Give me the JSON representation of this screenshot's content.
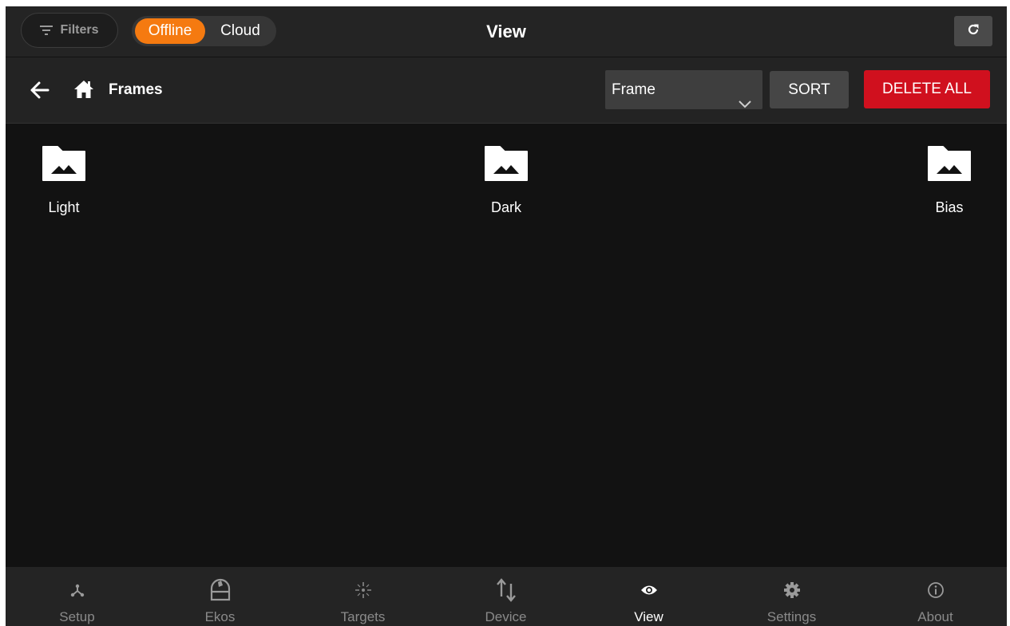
{
  "header": {
    "filters_label": "Filters",
    "mode_offline": "Offline",
    "mode_cloud": "Cloud",
    "title": "View"
  },
  "toolbar": {
    "breadcrumb": "Frames",
    "select_value": "Frame",
    "sort_label": "SORT",
    "delete_all_label": "DELETE ALL"
  },
  "folders": [
    {
      "label": "Light",
      "icon": "image-folder-icon"
    },
    {
      "label": "Dark",
      "icon": "image-folder-icon"
    },
    {
      "label": "Bias",
      "icon": "image-folder-icon"
    }
  ],
  "nav": [
    {
      "label": "Setup",
      "icon": "setup-icon",
      "active": false
    },
    {
      "label": "Ekos",
      "icon": "ekos-icon",
      "active": false
    },
    {
      "label": "Targets",
      "icon": "targets-icon",
      "active": false
    },
    {
      "label": "Device",
      "icon": "device-icon",
      "active": false
    },
    {
      "label": "View",
      "icon": "eye-icon",
      "active": true
    },
    {
      "label": "Settings",
      "icon": "gear-icon",
      "active": false
    },
    {
      "label": "About",
      "icon": "info-icon",
      "active": false
    }
  ],
  "colors": {
    "accent": "#f57a10",
    "danger": "#d0101e",
    "background": "#121212",
    "bar": "#242424"
  }
}
